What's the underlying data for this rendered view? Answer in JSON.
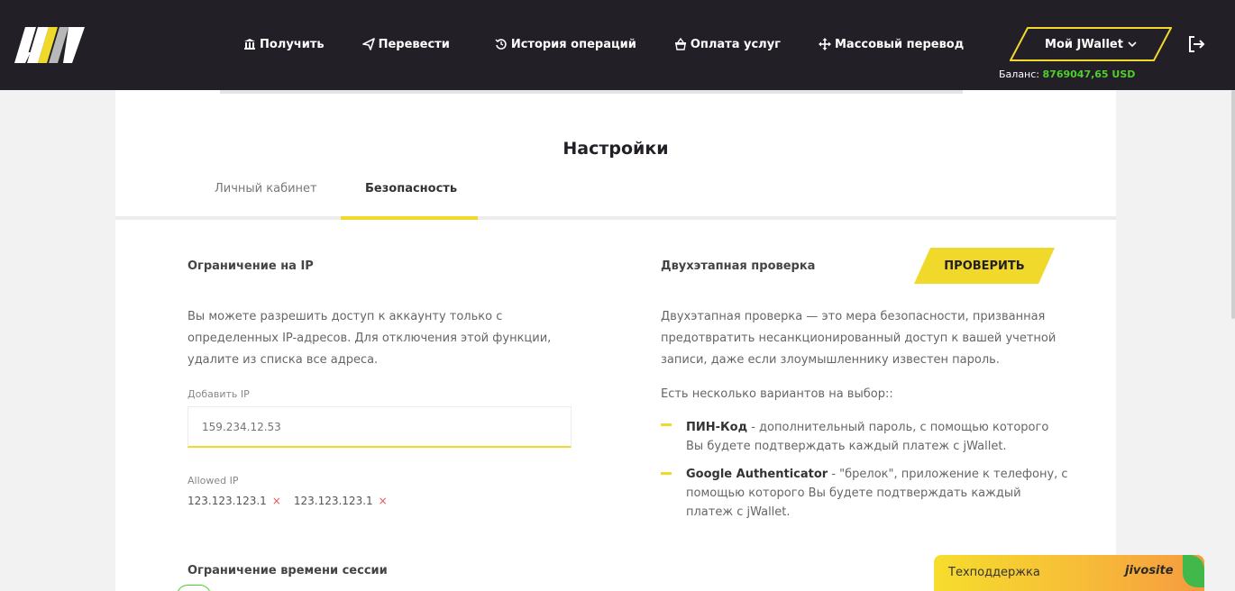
{
  "header": {
    "logo_text": "JW",
    "nav": [
      {
        "label": "Получить",
        "icon": "bank-icon"
      },
      {
        "label": "Перевести",
        "icon": "paper-plane-icon"
      },
      {
        "label": "История операций",
        "icon": "history-icon"
      },
      {
        "label": "Оплата услуг",
        "icon": "basket-icon"
      },
      {
        "label": "Массовый перевод",
        "icon": "arrows-cross-icon"
      }
    ],
    "wallet_button": "Мой JWallet",
    "balance_label": "Баланс:",
    "balance_value": "8769047,65 USD",
    "colors": {
      "background": "#231f27",
      "accent": "#f0d92b",
      "balance": "#4fcf2b"
    }
  },
  "page": {
    "title": "Настройки",
    "tabs": [
      {
        "label": "Личный кабинет",
        "active": false
      },
      {
        "label": "Безопасность",
        "active": true
      }
    ]
  },
  "ip_section": {
    "title": "Ограничение на IP",
    "description_lines": [
      "Вы можете разрешить доступ к аккаунту только с",
      "определенных IP-адресов. Для отключения этой функции,",
      "удалите из списка все адреса."
    ],
    "add_label": "Добавить IP",
    "input_placeholder": "159.234.12.53",
    "allowed_label": "Allowed IP",
    "allowed_ips": [
      "123.123.123.1",
      "123.123.123.1"
    ],
    "remove_symbol": "×"
  },
  "session_section": {
    "title": "Ограничение времени сессии"
  },
  "two_step": {
    "title": "Двухэтапная проверка",
    "verify_button": "ПРОВЕРИТЬ",
    "description_lines": [
      "Двухэтапная проверка — это мера безопасности, призванная",
      "предотвратить несанкционированный доступ к вашей учетной",
      "записи, даже если злоумышленнику известен пароль."
    ],
    "options_intro": "Есть несколько вариантов на выбор::",
    "options": [
      {
        "name": "ПИН-Код",
        "line1": " - дополнительный пароль, с помощью которого",
        "line2": "Вы будете подтверждать каждый платеж с jWallet."
      },
      {
        "name": "Google Authenticator",
        "line1": " - \"брелок\", приложение к телефону, с",
        "line2": "помощью которого Вы будете подтверждать каждый",
        "line3": "платеж с jWallet."
      }
    ]
  },
  "support_widget": {
    "label": "Техподдержка",
    "brand": "jivosite"
  }
}
